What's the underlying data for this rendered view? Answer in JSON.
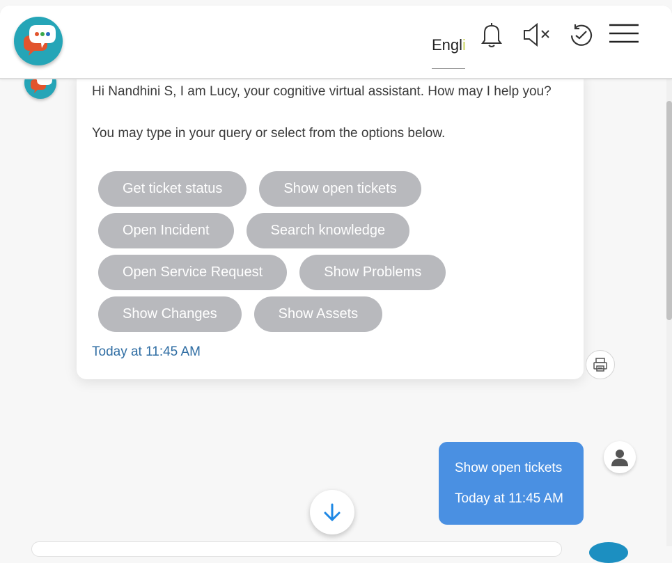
{
  "header": {
    "language_label": "Engl",
    "language_fade": "i",
    "icons": [
      "chat-logo-icon",
      "bell-icon",
      "mute-icon",
      "history-icon",
      "menu-icon"
    ]
  },
  "bot_message": {
    "greeting": "Hi Nandhini S, I am Lucy, your cognitive virtual assistant. How may I help you?",
    "hint": "You may type in your query or select from the options below.",
    "options": [
      [
        "Get ticket status",
        "Show open tickets"
      ],
      [
        "Open Incident",
        "Search knowledge"
      ],
      [
        "Open Service Request",
        "Show Problems"
      ],
      [
        "Show Changes",
        "Show Assets"
      ]
    ],
    "timestamp": "Today at 11:45 AM"
  },
  "user_message": {
    "text": "Show open tickets",
    "timestamp": "Today at 11:45 AM"
  },
  "colors": {
    "brand_teal": "#25a5b7",
    "option_chip": "#b8b9bd",
    "user_bubble": "#4a90e2",
    "timestamp_link": "#2f6da3",
    "scroll_arrow": "#1e88e5"
  }
}
